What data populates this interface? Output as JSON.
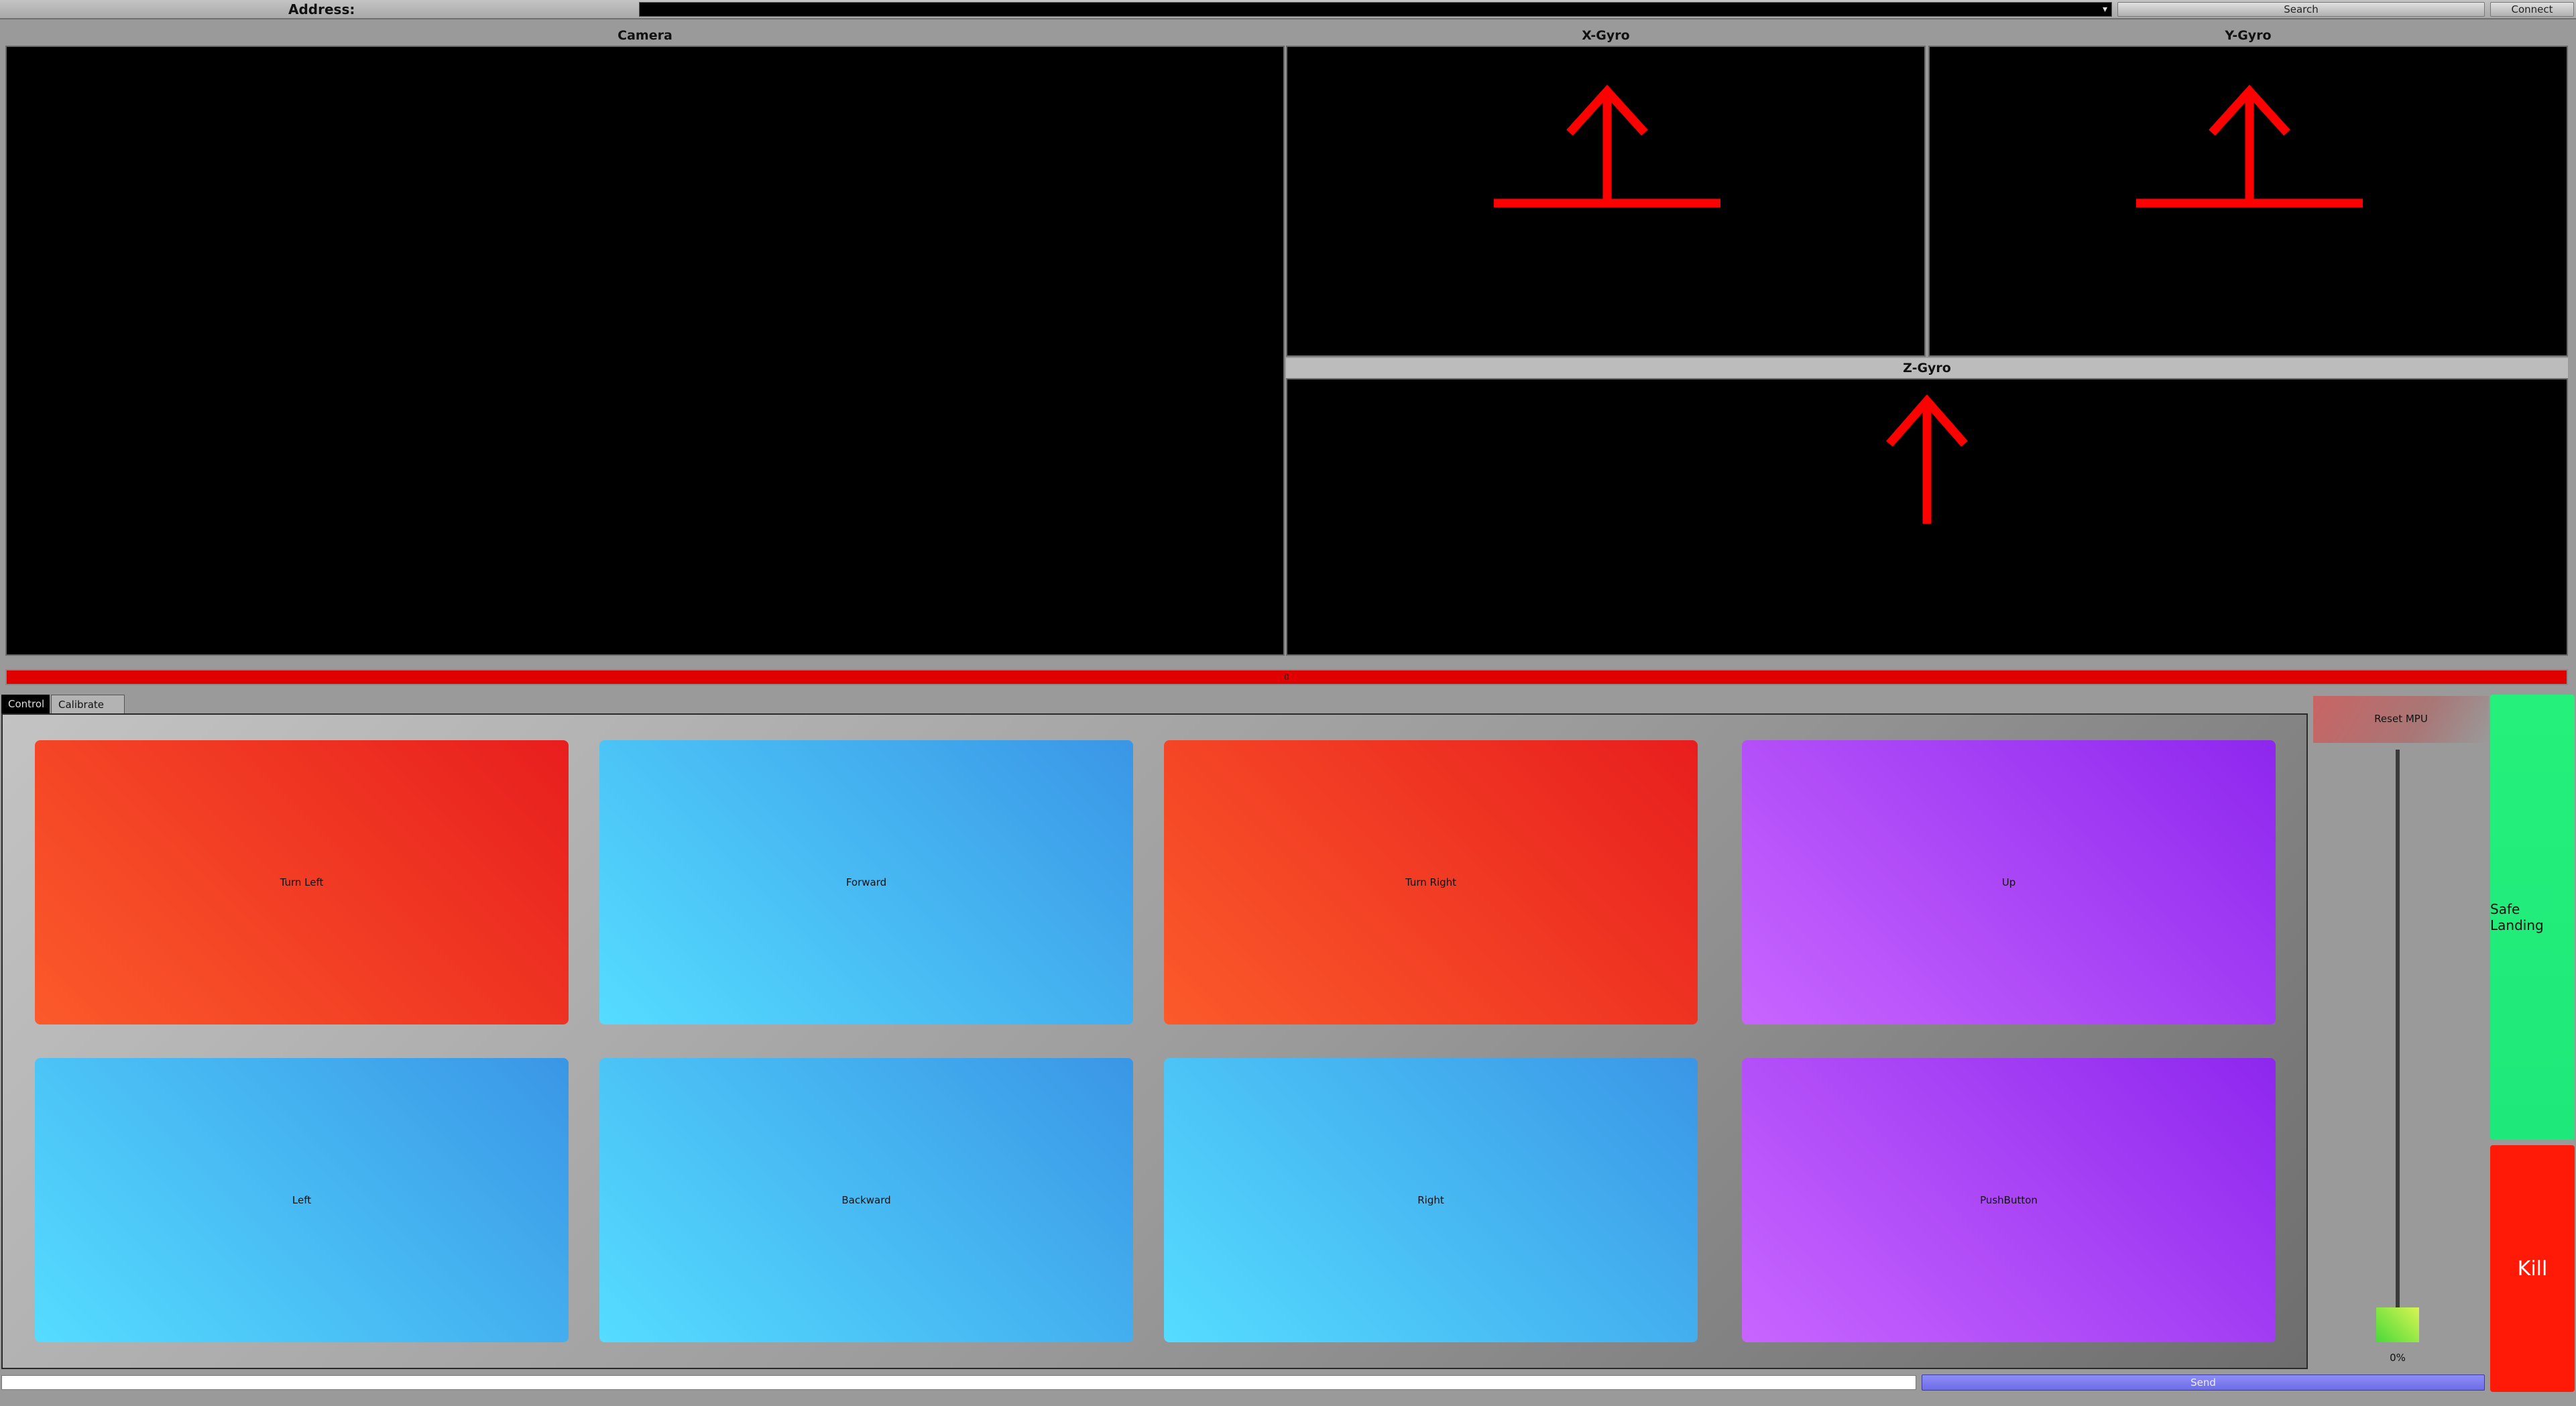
{
  "topbar": {
    "address_label": "Address:",
    "address_value": "",
    "dropdown_icon": "chevron-down-icon",
    "search_label": "Search",
    "connect_label": "Connect"
  },
  "panels": {
    "camera_title": "Camera",
    "xgyro_title": "X-Gyro",
    "ygyro_title": "Y-Gyro",
    "zgyro_title": "Z-Gyro"
  },
  "progress": {
    "label": "0",
    "fraction": 1.0,
    "color": "#e00000"
  },
  "tabs": [
    {
      "label": "Control",
      "active": true
    },
    {
      "label": "Calibrate PID",
      "active": false
    }
  ],
  "pads": [
    {
      "label": "Turn Left",
      "color": "red"
    },
    {
      "label": "Forward",
      "color": "blue"
    },
    {
      "label": "Turn Right",
      "color": "red"
    },
    {
      "label": "Up",
      "color": "purple"
    },
    {
      "label": "Left",
      "color": "blue"
    },
    {
      "label": "Backward",
      "color": "blue"
    },
    {
      "label": "Right",
      "color": "blue"
    },
    {
      "label": "PushButton",
      "color": "purple"
    }
  ],
  "side": {
    "reset_mpu_label": "Reset MPU",
    "throttle_value": "0%",
    "throttle_fraction": 0.0,
    "safe_landing_label": "Safe Landing",
    "kill_label": "Kill"
  },
  "bottom": {
    "command_value": "",
    "send_label": "Send"
  },
  "colors": {
    "indicator_arrow": "#ff0000",
    "red_pad": "#e81e1e",
    "blue_pad": "#3a96e6",
    "purple_pad": "#8e27ee",
    "safe_landing": "#25f07b",
    "kill": "#ff1a07"
  }
}
